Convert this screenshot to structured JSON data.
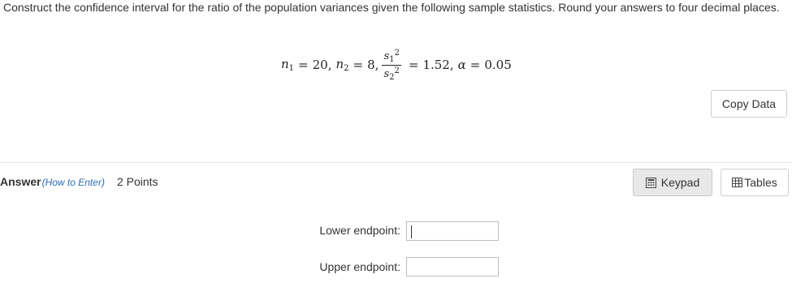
{
  "question": {
    "text": "Construct the confidence interval for the ratio of the population variances given the following sample statistics. Round your answers to four decimal places."
  },
  "formula": {
    "n1_value": "20",
    "n2_value": "8",
    "ratio_value": "1.52",
    "alpha_value": "0.05"
  },
  "buttons": {
    "copy_data": "Copy Data",
    "keypad": "Keypad",
    "tables": "Tables"
  },
  "answer": {
    "label": "Answer",
    "how_to": "(How to Enter)",
    "points": "2 Points"
  },
  "fields": {
    "lower_label": "Lower endpoint:",
    "lower_value": "",
    "upper_label": "Upper endpoint:",
    "upper_value": ""
  },
  "icons": {
    "keypad": "keypad-icon",
    "tables": "table-icon"
  }
}
